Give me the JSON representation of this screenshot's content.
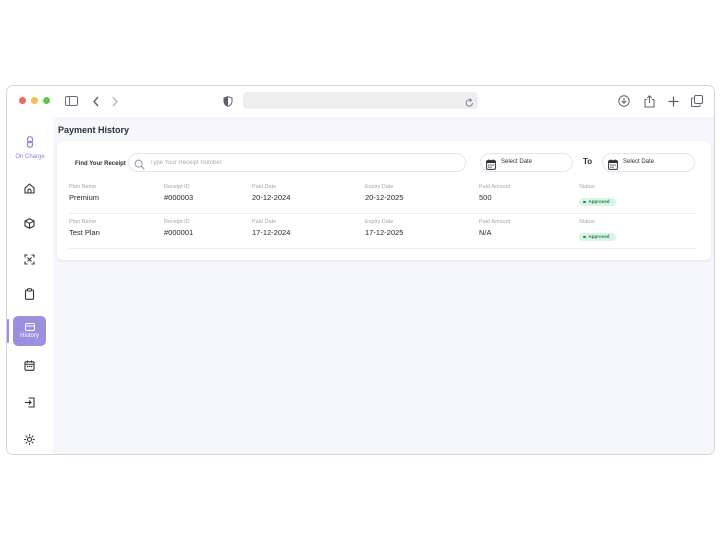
{
  "app": {
    "brand": "On Charge",
    "page_title": "Payment History"
  },
  "sidebar": {
    "items": [
      {
        "name": "home",
        "icon": "home-icon"
      },
      {
        "name": "packages",
        "icon": "box-icon"
      },
      {
        "name": "scan",
        "icon": "scan-icon"
      },
      {
        "name": "orders",
        "icon": "clipboard-icon"
      },
      {
        "name": "history",
        "icon": "card-icon",
        "label": "History",
        "active": true
      },
      {
        "name": "calendar",
        "icon": "calendar-icon"
      },
      {
        "name": "login",
        "icon": "login-icon"
      },
      {
        "name": "settings",
        "icon": "sun-icon"
      }
    ]
  },
  "filters": {
    "find_label": "Find Your Receipt",
    "search_placeholder": "Type Your Receipt Number",
    "search_value": "",
    "from_placeholder": "Select Date",
    "to_label": "To",
    "to_placeholder": "Select Date"
  },
  "columns": {
    "plan": "Plan Name",
    "receipt": "Receipt ID",
    "paid": "Paid Date",
    "expiry": "Expiry Date",
    "amount": "Paid Amount",
    "status": "Status"
  },
  "payments": [
    {
      "plan": "Premium",
      "receipt": "#000003",
      "paid": "20-12-2024",
      "expiry": "20-12-2025",
      "amount": "500",
      "status": "Approved"
    },
    {
      "plan": "Test Plan",
      "receipt": "#000001",
      "paid": "17-12-2024",
      "expiry": "17-12-2025",
      "amount": "N/A",
      "status": "Approved"
    }
  ],
  "colors": {
    "accent": "#9b8fe0",
    "status_approved_bg": "#d9f4e4",
    "status_approved_text": "#23834d"
  }
}
